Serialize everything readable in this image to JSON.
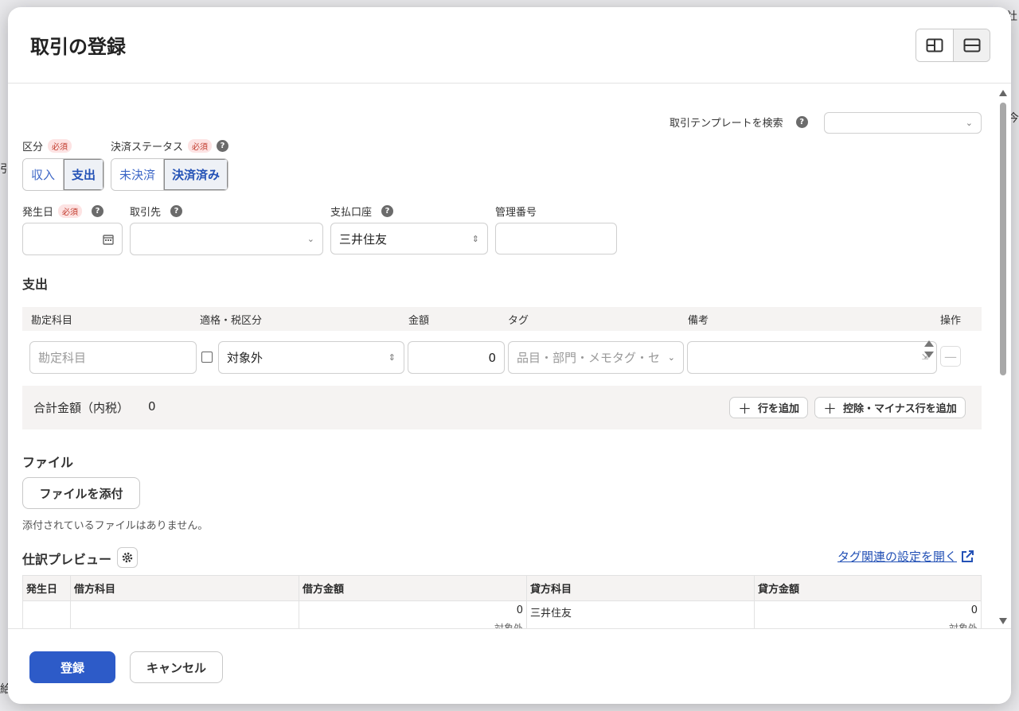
{
  "background": {
    "frag_right_top": "社",
    "frag_right_mid": "今",
    "frag_left_mid": "引",
    "frag_left_bottom": "給"
  },
  "modal": {
    "title": "取引の登録",
    "template_search_label": "取引テンプレートを検索",
    "help_glyph": "?",
    "required_badge": "必須",
    "kubun": {
      "label": "区分",
      "options": [
        "収入",
        "支出"
      ],
      "selected": "支出"
    },
    "status": {
      "label": "決済ステータス",
      "options": [
        "未決済",
        "決済済み"
      ],
      "selected": "決済済み"
    },
    "hasseibi": {
      "label": "発生日",
      "value": ""
    },
    "torihikisaki": {
      "label": "取引先",
      "value": ""
    },
    "shiharai_koza": {
      "label": "支払口座",
      "value": "三井住友"
    },
    "kanri_bango": {
      "label": "管理番号",
      "value": ""
    },
    "expense_section": "支出",
    "line_headers": {
      "account": "勘定科目",
      "tax": "適格・税区分",
      "amount": "金額",
      "tag": "タグ",
      "memo": "備考",
      "ops": "操作"
    },
    "line": {
      "account_placeholder": "勘定科目",
      "tax_value": "対象外",
      "amount_value": "0",
      "tag_placeholder": "品目・部門・メモタグ・セ"
    },
    "total": {
      "label": "合計金額（内税）",
      "value": "0"
    },
    "add_row": "行を追加",
    "add_deduction_row": "控除・マイナス行を追加",
    "file_section": "ファイル",
    "attach_button": "ファイルを添付",
    "no_files": "添付されているファイルはありません。",
    "preview_title": "仕訳プレビュー",
    "tag_settings_link": "タグ関連の設定を開く",
    "preview_headers": [
      "発生日",
      "借方科目",
      "借方金額",
      "貸方科目",
      "貸方金額"
    ],
    "preview_row": {
      "date": "",
      "debit_account": "",
      "debit_amount": "0",
      "debit_tax": "対象外",
      "credit_account": "三井住友",
      "credit_amount": "0",
      "credit_tax": "対象外"
    },
    "submit": "登録",
    "cancel": "キャンセル"
  }
}
